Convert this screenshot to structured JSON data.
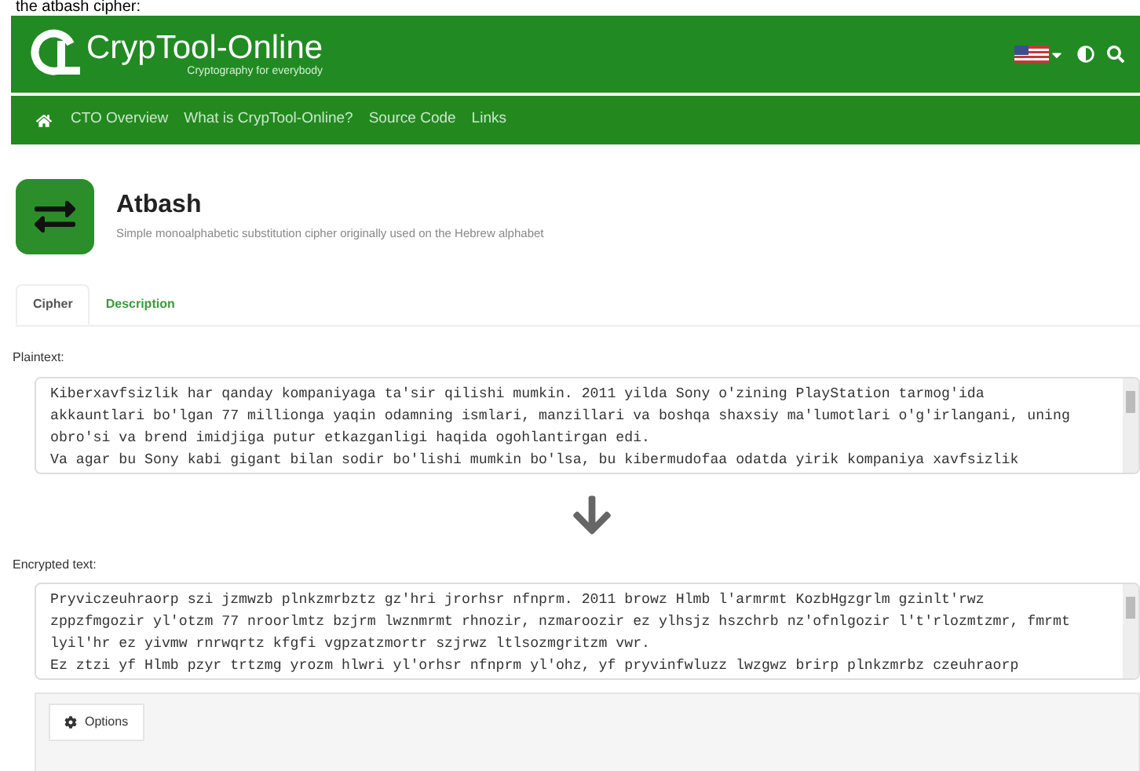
{
  "caption": "the atbash cipher:",
  "header": {
    "logo_text": "CrypTool-Online",
    "tagline": "Cryptography for everybody"
  },
  "nav": {
    "items": [
      "CTO Overview",
      "What is CrypTool-Online?",
      "Source Code",
      "Links"
    ]
  },
  "tool": {
    "title": "Atbash",
    "subtitle": "Simple monoalphabetic substitution cipher originally used on the Hebrew alphabet"
  },
  "tabs": [
    {
      "label": "Cipher",
      "selected": true
    },
    {
      "label": "Description",
      "selected": false
    }
  ],
  "plaintext": {
    "label": "Plaintext:",
    "value": "Kiberxavfsizlik har qanday kompaniyaga ta'sir qilishi mumkin. 2011 yilda Sony o'zining PlayStation tarmog'ida\nakkauntlari bo'lgan 77 millionga yaqin odamning ismlari, manzillari va boshqa shaxsiy ma'lumotlari o'g'irlangani, uning\nobro'si va brend imidjiga putur etkazganligi haqida ogohlantirgan edi.\nVa agar bu Sony kabi gigant bilan sodir bo'lishi mumkin bo'lsa, bu kibermudofaa odatda yirik kompaniya xavfsizlik"
  },
  "encrypted": {
    "label": "Encrypted text:",
    "value": "Pryviczeuhraorp szi jzmwzb plnkzmrbztz gz'hri jrorhsr nfnprm. 2011 browz Hlmb l'armrmt KozbHgzgrlm gzinlt'rwz\nzppzfmgozir yl'otzm 77 nroorlmtz bzjrm lwznmrmt rhnozir, nzmaroozir ez ylhsjz hszchrb nz'ofnlgozir l't'rlozmtzmr, fmrmt\nlyil'hr ez yivmw rnrwqrtz kfgfi vgpzatzmortr szjrwz ltlsozmgritzm vwr.\nEz ztzi yf Hlmb pzyr trtzmg yrozm hlwri yl'orhsr nfnprm yl'ohz, yf pryvinfwluzz lwzgwz brirp plnkzmrbz czeuhraorp"
  },
  "options": {
    "label": "Options"
  }
}
